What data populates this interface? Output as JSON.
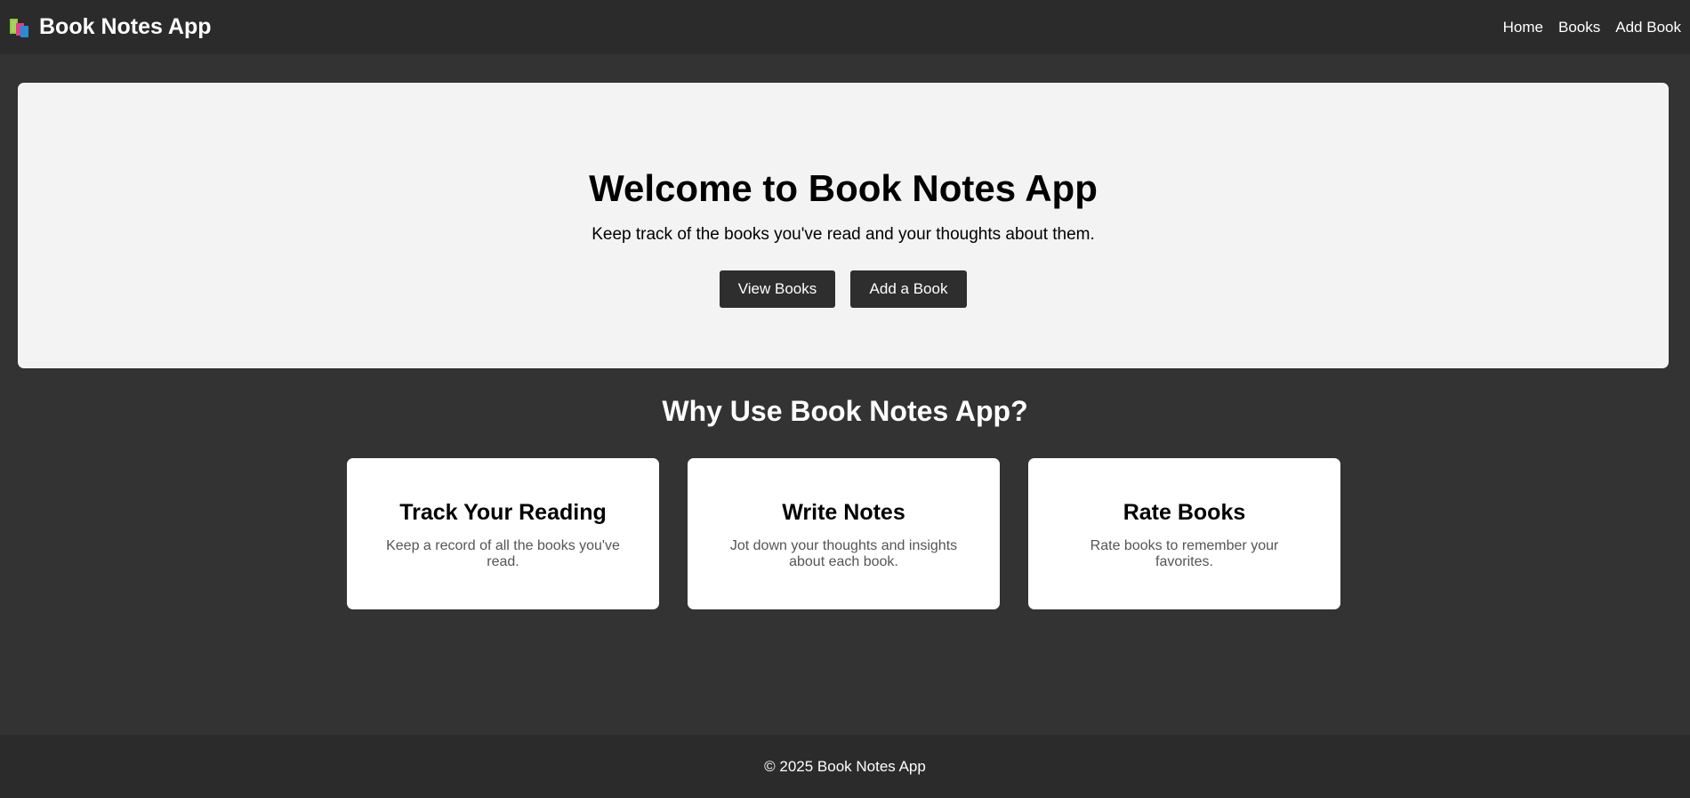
{
  "navbar": {
    "brand_icon": "books-icon",
    "title": "Book Notes App",
    "links": [
      {
        "label": "Home"
      },
      {
        "label": "Books"
      },
      {
        "label": "Add Book"
      }
    ]
  },
  "hero": {
    "title": "Welcome to Book Notes App",
    "subtitle": "Keep track of the books you've read and your thoughts about them.",
    "buttons": {
      "view_books": "View Books",
      "add_book": "Add a Book"
    }
  },
  "features": {
    "title": "Why Use Book Notes App?",
    "cards": [
      {
        "title": "Track Your Reading",
        "text": "Keep a record of all the books you've read."
      },
      {
        "title": "Write Notes",
        "text": "Jot down your thoughts and insights about each book."
      },
      {
        "title": "Rate Books",
        "text": "Rate books to remember your favorites."
      }
    ]
  },
  "footer": {
    "text": "© 2025 Book Notes App"
  },
  "colors": {
    "background": "#333333",
    "navbar": "#2b2b2b",
    "hero": "#f3f3f3",
    "button": "#2e2e2e",
    "card": "#ffffff"
  }
}
